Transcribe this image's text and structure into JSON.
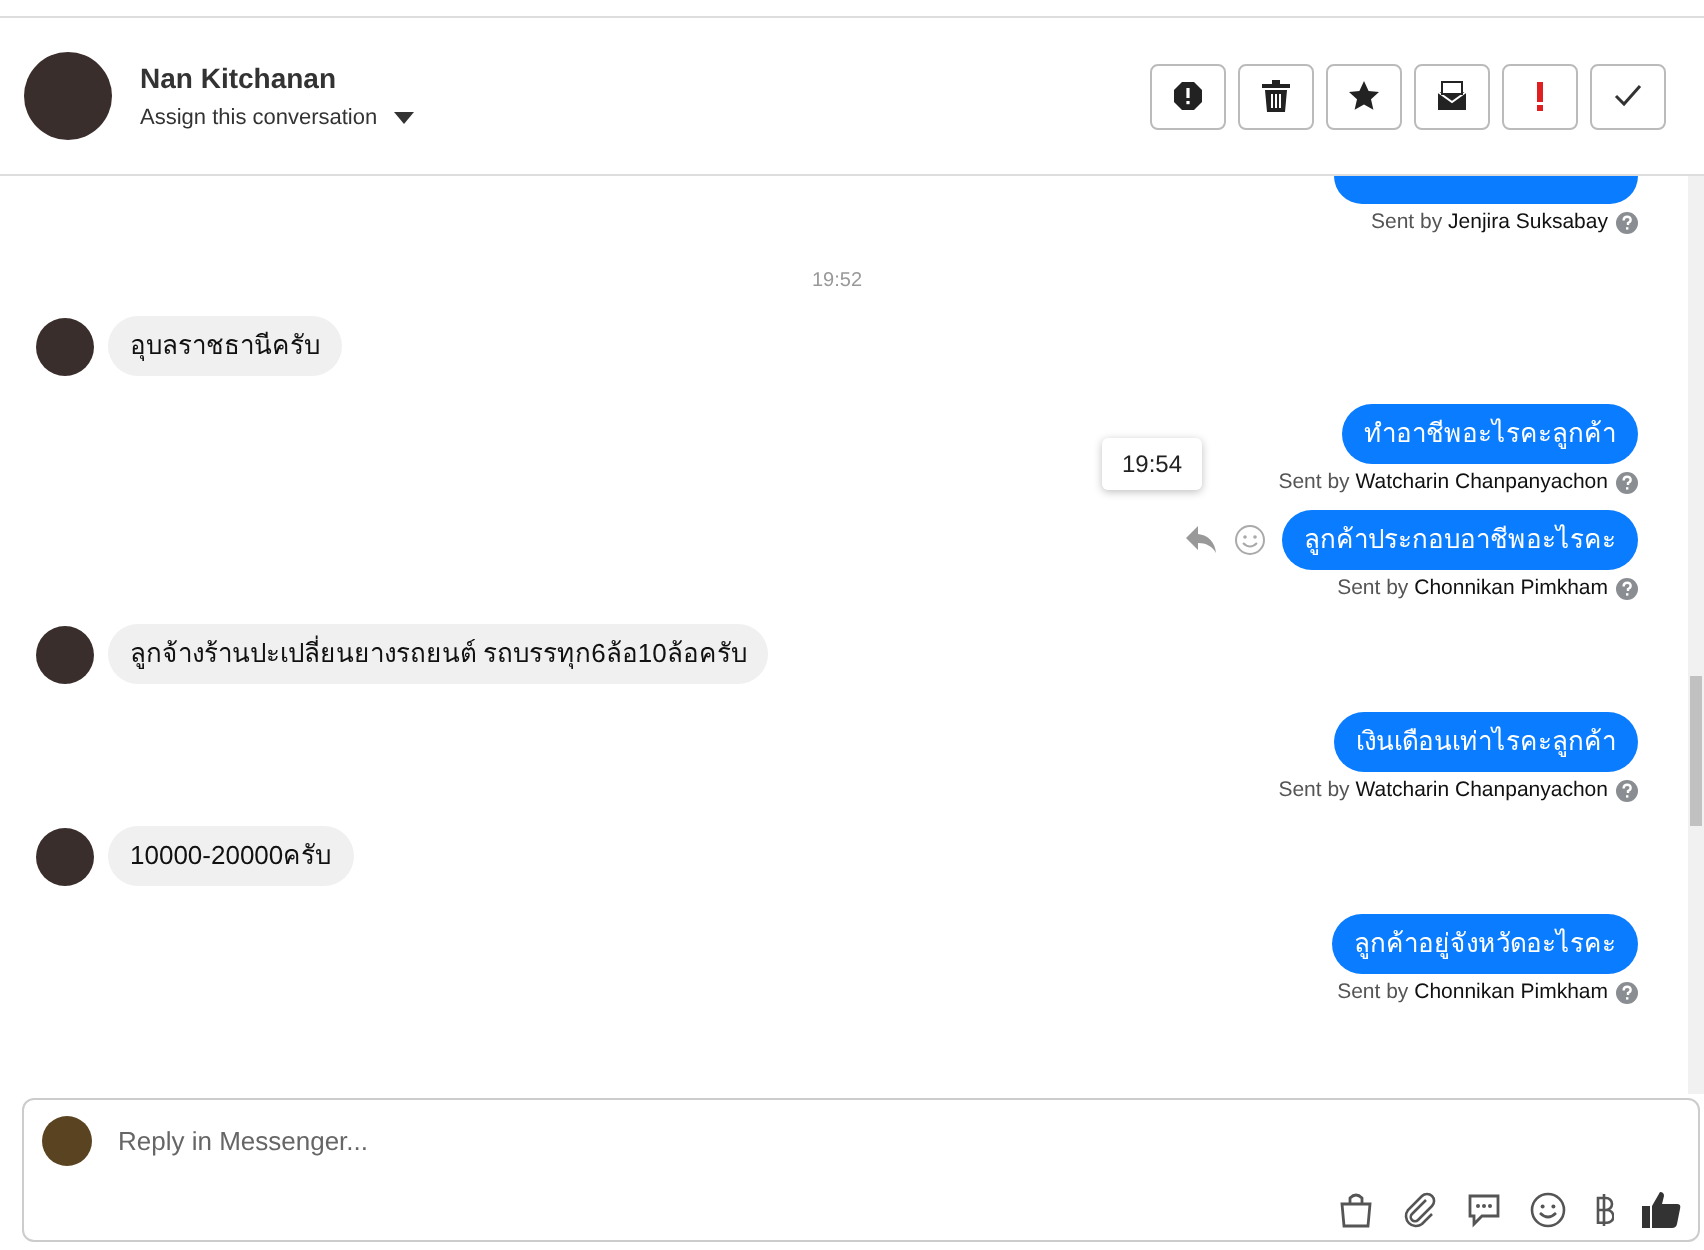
{
  "header": {
    "name": "Nan Kitchanan",
    "assign": "Assign this conversation",
    "actions": [
      {
        "kind": "spam"
      },
      {
        "kind": "trash"
      },
      {
        "kind": "star"
      },
      {
        "kind": "mail"
      },
      {
        "kind": "alert"
      },
      {
        "kind": "done"
      }
    ]
  },
  "messages": [
    {
      "kind": "out_tail",
      "sender": "Jenjira Suksabay",
      "sent_by": "Sent by",
      "show_actions": false
    },
    {
      "kind": "time",
      "text": "19:52"
    },
    {
      "kind": "in",
      "text": "อุบลราชธานีครับ"
    },
    {
      "kind": "out",
      "text": "ทำอาชีพอะไรคะลูกค้า",
      "sent_by": "Sent by",
      "sender": "Watcharin Chanpanyachon",
      "show_actions": false
    },
    {
      "kind": "out",
      "text": "ลูกค้าประกอบอาชีพอะไรคะ",
      "sent_by": "Sent by",
      "sender": "Chonnikan Pimkham",
      "show_actions": true,
      "tooltip": "19:54"
    },
    {
      "kind": "in",
      "text": "ลูกจ้างร้านปะเปลี่ยนยางรถยนต์ รถบรรทุก6ล้อ10ล้อครับ"
    },
    {
      "kind": "out",
      "text": "เงินเดือนเท่าไรคะลูกค้า",
      "sent_by": "Sent by",
      "sender": "Watcharin Chanpanyachon",
      "show_actions": false
    },
    {
      "kind": "in",
      "text": "10000-20000ครับ"
    },
    {
      "kind": "out",
      "text": "ลูกค้าอยู่จังหวัดอะไรคะ",
      "sent_by": "Sent by",
      "sender": "Chonnikan Pimkham",
      "show_actions": false
    }
  ],
  "composer": {
    "placeholder": "Reply in Messenger...",
    "tools": [
      {
        "kind": "bag"
      },
      {
        "kind": "clip"
      },
      {
        "kind": "chat"
      },
      {
        "kind": "smile"
      },
      {
        "kind": "baht"
      },
      {
        "kind": "like"
      }
    ]
  }
}
